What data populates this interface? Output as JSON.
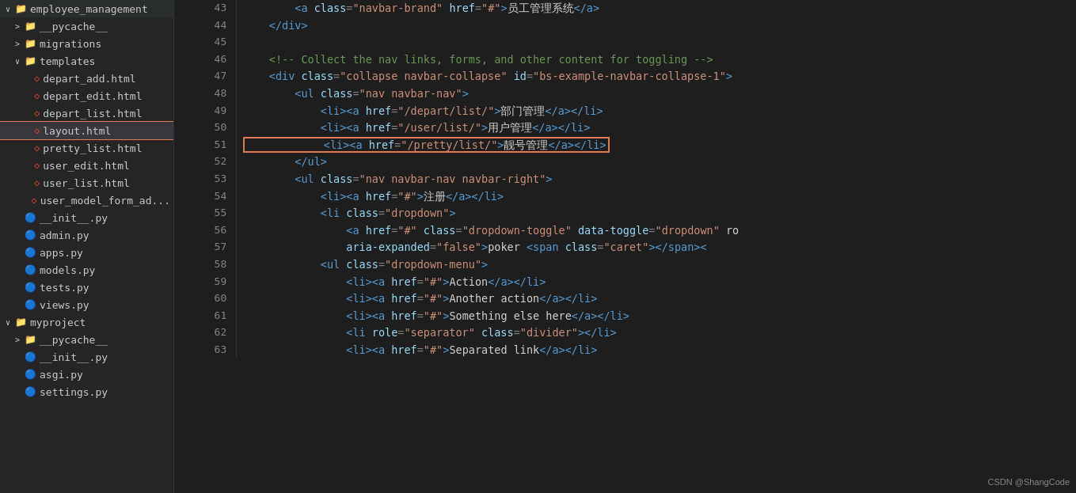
{
  "sidebar": {
    "items": [
      {
        "id": "employee_management",
        "label": "employee_management",
        "type": "folder",
        "expanded": true,
        "indent": 0,
        "arrow": "∨"
      },
      {
        "id": "__pycache__",
        "label": "__pycache__",
        "type": "folder",
        "expanded": false,
        "indent": 1,
        "arrow": ">"
      },
      {
        "id": "migrations",
        "label": "migrations",
        "type": "folder",
        "expanded": false,
        "indent": 1,
        "arrow": ">"
      },
      {
        "id": "templates",
        "label": "templates",
        "type": "folder",
        "expanded": true,
        "indent": 1,
        "arrow": "∨"
      },
      {
        "id": "depart_add.html",
        "label": "depart_add.html",
        "type": "html",
        "indent": 2
      },
      {
        "id": "depart_edit.html",
        "label": "depart_edit.html",
        "type": "html",
        "indent": 2
      },
      {
        "id": "depart_list.html",
        "label": "depart_list.html",
        "type": "html",
        "indent": 2
      },
      {
        "id": "layout.html",
        "label": "layout.html",
        "type": "html",
        "indent": 2,
        "selected": true
      },
      {
        "id": "pretty_list.html",
        "label": "pretty_list.html",
        "type": "html",
        "indent": 2
      },
      {
        "id": "user_edit.html",
        "label": "user_edit.html",
        "type": "html",
        "indent": 2
      },
      {
        "id": "user_list.html",
        "label": "user_list.html",
        "type": "html",
        "indent": 2
      },
      {
        "id": "user_model_form_ad...",
        "label": "user_model_form_ad...",
        "type": "html",
        "indent": 2
      },
      {
        "id": "__init__.py",
        "label": "__init__.py",
        "type": "py",
        "indent": 1
      },
      {
        "id": "admin.py",
        "label": "admin.py",
        "type": "py",
        "indent": 1
      },
      {
        "id": "apps.py",
        "label": "apps.py",
        "type": "py",
        "indent": 1
      },
      {
        "id": "models.py",
        "label": "models.py",
        "type": "py",
        "indent": 1
      },
      {
        "id": "tests.py",
        "label": "tests.py",
        "type": "py",
        "indent": 1
      },
      {
        "id": "views.py",
        "label": "views.py",
        "type": "py",
        "indent": 1
      },
      {
        "id": "myproject",
        "label": "myproject",
        "type": "folder",
        "expanded": true,
        "indent": 0,
        "arrow": "∨"
      },
      {
        "id": "__pycache__2",
        "label": "__pycache__",
        "type": "folder",
        "expanded": false,
        "indent": 1,
        "arrow": ">"
      },
      {
        "id": "__init__2.py",
        "label": "__init__.py",
        "type": "py",
        "indent": 1
      },
      {
        "id": "asgi.py",
        "label": "asgi.py",
        "type": "py",
        "indent": 1
      },
      {
        "id": "settings.py",
        "label": "settings.py",
        "type": "py",
        "indent": 1
      }
    ]
  },
  "editor": {
    "lines": [
      {
        "num": "43",
        "content": [
          {
            "type": "indent",
            "val": "        "
          },
          {
            "type": "tag",
            "val": "<a"
          },
          {
            "type": "attr-name",
            "val": " class"
          },
          {
            "type": "punct",
            "val": "="
          },
          {
            "type": "attr-value",
            "val": "\"navbar-brand\""
          },
          {
            "type": "attr-name",
            "val": " href"
          },
          {
            "type": "punct",
            "val": "="
          },
          {
            "type": "attr-value",
            "val": "\"#\""
          },
          {
            "type": "tag",
            "val": ">"
          },
          {
            "type": "text",
            "val": "员工管理系统"
          },
          {
            "type": "tag",
            "val": "</a>"
          }
        ]
      },
      {
        "num": "44",
        "content": [
          {
            "type": "indent",
            "val": "    "
          },
          {
            "type": "tag",
            "val": "</div>"
          }
        ]
      },
      {
        "num": "45",
        "content": []
      },
      {
        "num": "46",
        "content": [
          {
            "type": "indent",
            "val": "    "
          },
          {
            "type": "comment",
            "val": "<!-- Collect the nav links, forms, and other content for toggling -->"
          }
        ]
      },
      {
        "num": "47",
        "content": [
          {
            "type": "indent",
            "val": "    "
          },
          {
            "type": "tag",
            "val": "<div"
          },
          {
            "type": "attr-name",
            "val": " class"
          },
          {
            "type": "punct",
            "val": "="
          },
          {
            "type": "attr-value",
            "val": "\"collapse navbar-collapse\""
          },
          {
            "type": "attr-name",
            "val": " id"
          },
          {
            "type": "punct",
            "val": "="
          },
          {
            "type": "attr-value",
            "val": "\"bs-example-navbar-collapse-1\""
          },
          {
            "type": "tag",
            "val": ">"
          }
        ]
      },
      {
        "num": "48",
        "content": [
          {
            "type": "indent",
            "val": "        "
          },
          {
            "type": "tag",
            "val": "<ul"
          },
          {
            "type": "attr-name",
            "val": " class"
          },
          {
            "type": "punct",
            "val": "="
          },
          {
            "type": "attr-value",
            "val": "\"nav navbar-nav\""
          },
          {
            "type": "tag",
            "val": ">"
          }
        ]
      },
      {
        "num": "49",
        "content": [
          {
            "type": "indent",
            "val": "            "
          },
          {
            "type": "tag",
            "val": "<li><a"
          },
          {
            "type": "attr-name",
            "val": " href"
          },
          {
            "type": "punct",
            "val": "="
          },
          {
            "type": "attr-value",
            "val": "\"/depart/list/\""
          },
          {
            "type": "tag",
            "val": ">"
          },
          {
            "type": "text",
            "val": "部门管理"
          },
          {
            "type": "tag",
            "val": "</a></li>"
          }
        ]
      },
      {
        "num": "50",
        "content": [
          {
            "type": "indent",
            "val": "            "
          },
          {
            "type": "tag",
            "val": "<li><a"
          },
          {
            "type": "attr-name",
            "val": " href"
          },
          {
            "type": "punct",
            "val": "="
          },
          {
            "type": "attr-value",
            "val": "\"/user/list/\""
          },
          {
            "type": "tag",
            "val": ">"
          },
          {
            "type": "text",
            "val": "用户管理"
          },
          {
            "type": "tag",
            "val": "</a></li>"
          }
        ]
      },
      {
        "num": "51",
        "content": [
          {
            "type": "indent",
            "val": "            "
          },
          {
            "type": "highlighted",
            "val": true
          },
          {
            "type": "tag",
            "val": "<li><a"
          },
          {
            "type": "attr-name",
            "val": " href"
          },
          {
            "type": "punct",
            "val": "="
          },
          {
            "type": "attr-value",
            "val": "\"/pretty/list/\""
          },
          {
            "type": "tag",
            "val": ">"
          },
          {
            "type": "text",
            "val": "靓号管理"
          },
          {
            "type": "tag",
            "val": "</a></li>"
          }
        ]
      },
      {
        "num": "52",
        "content": [
          {
            "type": "indent",
            "val": "        "
          },
          {
            "type": "tag",
            "val": "</ul>"
          }
        ]
      },
      {
        "num": "53",
        "content": [
          {
            "type": "indent",
            "val": "        "
          },
          {
            "type": "tag",
            "val": "<ul"
          },
          {
            "type": "attr-name",
            "val": " class"
          },
          {
            "type": "punct",
            "val": "="
          },
          {
            "type": "attr-value",
            "val": "\"nav navbar-nav navbar-right\""
          },
          {
            "type": "tag",
            "val": ">"
          }
        ]
      },
      {
        "num": "54",
        "content": [
          {
            "type": "indent",
            "val": "            "
          },
          {
            "type": "tag",
            "val": "<li><a"
          },
          {
            "type": "attr-name",
            "val": " href"
          },
          {
            "type": "punct",
            "val": "="
          },
          {
            "type": "attr-value",
            "val": "\"#\""
          },
          {
            "type": "tag",
            "val": ">"
          },
          {
            "type": "text",
            "val": "注册"
          },
          {
            "type": "tag",
            "val": "</a></li>"
          }
        ]
      },
      {
        "num": "55",
        "content": [
          {
            "type": "indent",
            "val": "            "
          },
          {
            "type": "tag",
            "val": "<li"
          },
          {
            "type": "attr-name",
            "val": " class"
          },
          {
            "type": "punct",
            "val": "="
          },
          {
            "type": "attr-value",
            "val": "\"dropdown\""
          },
          {
            "type": "tag",
            "val": ">"
          }
        ]
      },
      {
        "num": "56",
        "content": [
          {
            "type": "indent",
            "val": "                "
          },
          {
            "type": "tag",
            "val": "<a"
          },
          {
            "type": "attr-name",
            "val": " href"
          },
          {
            "type": "punct",
            "val": "="
          },
          {
            "type": "attr-value",
            "val": "\"#\""
          },
          {
            "type": "attr-name",
            "val": " class"
          },
          {
            "type": "punct",
            "val": "="
          },
          {
            "type": "attr-value",
            "val": "\"dropdown-toggle\""
          },
          {
            "type": "attr-name",
            "val": " data-toggle"
          },
          {
            "type": "punct",
            "val": "="
          },
          {
            "type": "attr-value",
            "val": "\"dropdown\""
          },
          {
            "type": "text",
            "val": " ro"
          }
        ]
      },
      {
        "num": "57",
        "content": [
          {
            "type": "indent",
            "val": "                "
          },
          {
            "type": "attr-name",
            "val": "aria-expanded"
          },
          {
            "type": "punct",
            "val": "="
          },
          {
            "type": "attr-value",
            "val": "\"false\""
          },
          {
            "type": "tag",
            "val": ">"
          },
          {
            "type": "text",
            "val": "poker "
          },
          {
            "type": "tag",
            "val": "<span"
          },
          {
            "type": "attr-name",
            "val": " class"
          },
          {
            "type": "punct",
            "val": "="
          },
          {
            "type": "attr-value",
            "val": "\"caret\""
          },
          {
            "type": "tag",
            "val": "></span><"
          }
        ]
      },
      {
        "num": "58",
        "content": [
          {
            "type": "indent",
            "val": "            "
          },
          {
            "type": "tag",
            "val": "<ul"
          },
          {
            "type": "attr-name",
            "val": " class"
          },
          {
            "type": "punct",
            "val": "="
          },
          {
            "type": "attr-value",
            "val": "\"dropdown-menu\""
          },
          {
            "type": "tag",
            "val": ">"
          }
        ]
      },
      {
        "num": "59",
        "content": [
          {
            "type": "indent",
            "val": "                "
          },
          {
            "type": "tag",
            "val": "<li><a"
          },
          {
            "type": "attr-name",
            "val": " href"
          },
          {
            "type": "punct",
            "val": "="
          },
          {
            "type": "attr-value",
            "val": "\"#\""
          },
          {
            "type": "tag",
            "val": ">"
          },
          {
            "type": "text",
            "val": "Action"
          },
          {
            "type": "tag",
            "val": "</a></li>"
          }
        ]
      },
      {
        "num": "60",
        "content": [
          {
            "type": "indent",
            "val": "                "
          },
          {
            "type": "tag",
            "val": "<li><a"
          },
          {
            "type": "attr-name",
            "val": " href"
          },
          {
            "type": "punct",
            "val": "="
          },
          {
            "type": "attr-value",
            "val": "\"#\""
          },
          {
            "type": "tag",
            "val": ">"
          },
          {
            "type": "text",
            "val": "Another action"
          },
          {
            "type": "tag",
            "val": "</a></li>"
          }
        ]
      },
      {
        "num": "61",
        "content": [
          {
            "type": "indent",
            "val": "                "
          },
          {
            "type": "tag",
            "val": "<li><a"
          },
          {
            "type": "attr-name",
            "val": " href"
          },
          {
            "type": "punct",
            "val": "="
          },
          {
            "type": "attr-value",
            "val": "\"#\""
          },
          {
            "type": "tag",
            "val": ">"
          },
          {
            "type": "text",
            "val": "Something else here"
          },
          {
            "type": "tag",
            "val": "</a></li>"
          }
        ]
      },
      {
        "num": "62",
        "content": [
          {
            "type": "indent",
            "val": "                "
          },
          {
            "type": "tag",
            "val": "<li"
          },
          {
            "type": "attr-name",
            "val": " role"
          },
          {
            "type": "punct",
            "val": "="
          },
          {
            "type": "attr-value",
            "val": "\"separator\""
          },
          {
            "type": "attr-name",
            "val": " class"
          },
          {
            "type": "punct",
            "val": "="
          },
          {
            "type": "attr-value",
            "val": "\"divider\""
          },
          {
            "type": "tag",
            "val": "></li>"
          }
        ]
      },
      {
        "num": "63",
        "content": [
          {
            "type": "indent",
            "val": "                "
          },
          {
            "type": "tag",
            "val": "<li><a"
          },
          {
            "type": "attr-name",
            "val": " href"
          },
          {
            "type": "punct",
            "val": "="
          },
          {
            "type": "attr-value",
            "val": "\"#\""
          },
          {
            "type": "tag",
            "val": ">"
          },
          {
            "type": "text",
            "val": "Separated link"
          },
          {
            "type": "tag",
            "val": "</a></li>"
          }
        ]
      }
    ]
  },
  "watermark": "CSDN @ShangCode"
}
